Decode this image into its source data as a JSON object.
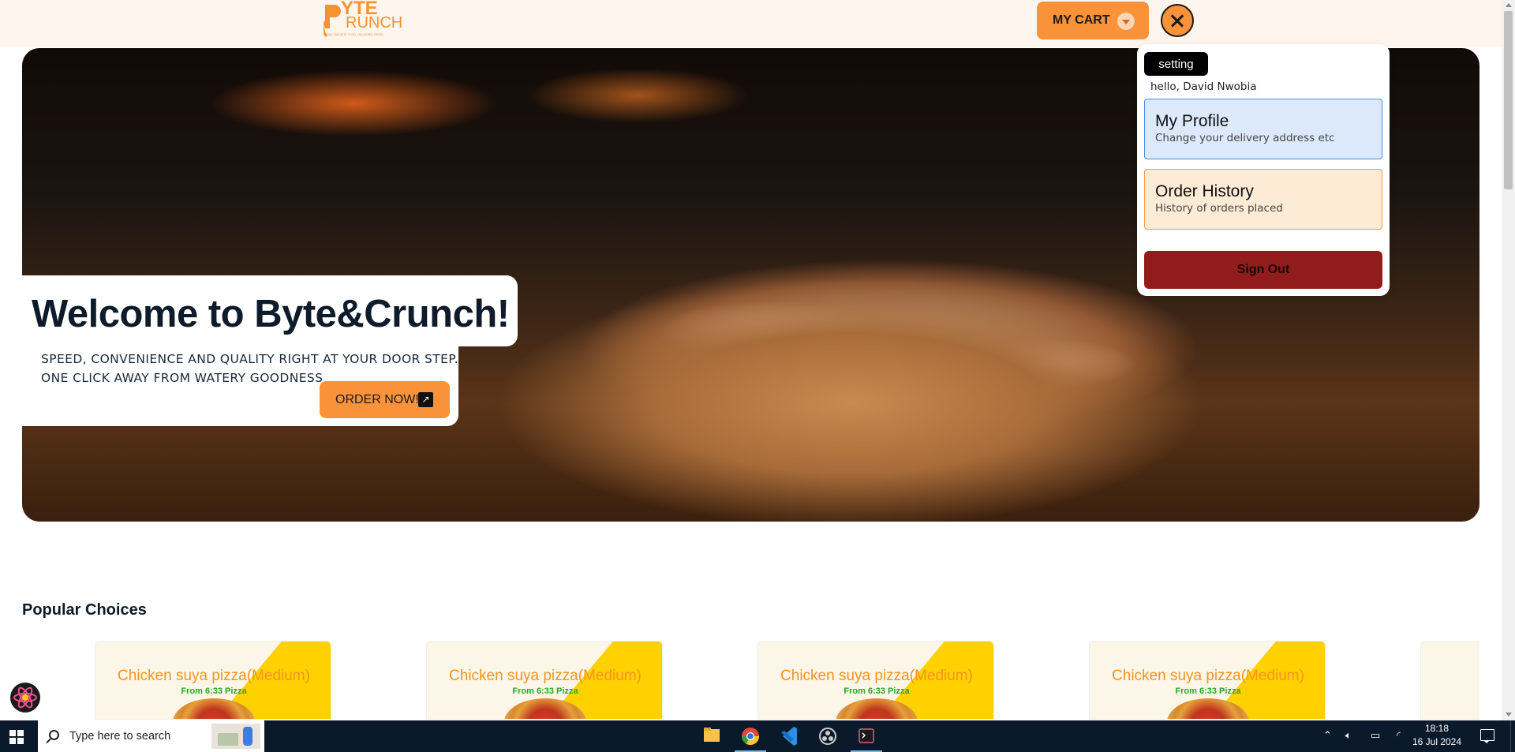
{
  "header": {
    "logo_line1": "YTE",
    "logo_line2": "RUNCH",
    "logo_tagline": "YOUR FAVORITE FOOD, DELIVERED FRESH",
    "cart_label": "MY CART"
  },
  "hero": {
    "title": "Welcome to Byte&Crunch!",
    "subtitle_line1": "SPEED, CONVENIENCE AND QUALITY RIGHT AT YOUR DOOR STEP.",
    "subtitle_line2": "ONE CLICK AWAY FROM WATERY GOODNESS",
    "cta_label": "ORDER NOW!",
    "cta_icon": "arrow-up-right-icon"
  },
  "account_menu": {
    "tag": "setting",
    "greeting": "hello, David Nwobia",
    "items": [
      {
        "title": "My Profile",
        "subtitle": "Change your delivery address etc"
      },
      {
        "title": "Order History",
        "subtitle": "History of orders placed"
      }
    ],
    "sign_out": "Sign Out"
  },
  "popular": {
    "title": "Popular Choices",
    "products": [
      {
        "name": "Chicken suya pizza(Medium)",
        "price": "From 6:33 Pizza"
      },
      {
        "name": "Chicken suya pizza(Medium)",
        "price": "From 6:33 Pizza"
      },
      {
        "name": "Chicken suya pizza(Medium)",
        "price": "From 6:33 Pizza"
      },
      {
        "name": "Chicken suya pizza(Medium)",
        "price": "From 6:33 Pizza"
      }
    ]
  },
  "taskbar": {
    "search_placeholder": "Type here to search",
    "time": "18:18",
    "date": "16 Jul 2024"
  },
  "colors": {
    "brand_orange": "#fa923a",
    "signout_red": "#921c1c",
    "header_bg": "#fdf5ee",
    "taskbar_bg": "#0b1a2b"
  }
}
